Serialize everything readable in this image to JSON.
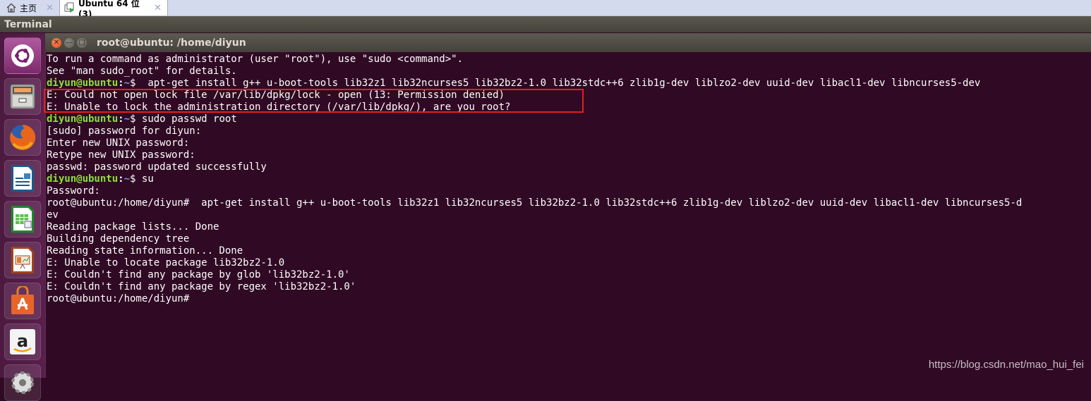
{
  "vmware_tabs": [
    {
      "label": "主页",
      "icon": "home-icon"
    },
    {
      "label": "Ubuntu 64 位 (3)",
      "icon": "vm-running-icon"
    }
  ],
  "panel": {
    "app_name": "Terminal"
  },
  "window": {
    "title": "root@ubuntu: /home/diyun"
  },
  "launcher": [
    {
      "name": "dash-home",
      "icon": "ubuntu-logo-icon"
    },
    {
      "name": "files",
      "icon": "file-cabinet-icon"
    },
    {
      "name": "firefox",
      "icon": "firefox-icon"
    },
    {
      "name": "libreoffice-writer",
      "icon": "writer-document-icon"
    },
    {
      "name": "libreoffice-calc",
      "icon": "calc-spreadsheet-icon"
    },
    {
      "name": "libreoffice-impress",
      "icon": "impress-presentation-icon"
    },
    {
      "name": "software-center",
      "icon": "shopping-bag-icon"
    },
    {
      "name": "amazon",
      "icon": "amazon-icon"
    },
    {
      "name": "system-settings",
      "icon": "gear-icon"
    }
  ],
  "terminal": {
    "lines": [
      {
        "type": "out",
        "text": "To run a command as administrator (user \"root\"), use \"sudo <command>\"."
      },
      {
        "type": "out",
        "text": "See \"man sudo_root\" for details."
      },
      {
        "type": "user",
        "prompt_user": "diyun@ubuntu",
        "prompt_path": "~",
        "prompt_sym": "$",
        "cmd": "  apt-get install g++ u-boot-tools lib32z1 lib32ncurses5 lib32bz2-1.0 lib32stdc++6 zlib1g-dev liblzo2-dev uuid-dev libacl1-dev libncurses5-dev"
      },
      {
        "type": "out",
        "text": "E: Could not open lock file /var/lib/dpkg/lock - open (13: Permission denied)"
      },
      {
        "type": "out",
        "text": "E: Unable to lock the administration directory (/var/lib/dpkg/), are you root?"
      },
      {
        "type": "user",
        "prompt_user": "diyun@ubuntu",
        "prompt_path": "~",
        "prompt_sym": "$",
        "cmd": " sudo passwd root"
      },
      {
        "type": "out",
        "text": "[sudo] password for diyun:"
      },
      {
        "type": "out",
        "text": "Enter new UNIX password:"
      },
      {
        "type": "out",
        "text": "Retype new UNIX password:"
      },
      {
        "type": "out",
        "text": "passwd: password updated successfully"
      },
      {
        "type": "user",
        "prompt_user": "diyun@ubuntu",
        "prompt_path": "~",
        "prompt_sym": "$",
        "cmd": " su"
      },
      {
        "type": "out",
        "text": "Password:"
      },
      {
        "type": "out",
        "text": "root@ubuntu:/home/diyun#  apt-get install g++ u-boot-tools lib32z1 lib32ncurses5 lib32bz2-1.0 lib32stdc++6 zlib1g-dev liblzo2-dev uuid-dev libacl1-dev libncurses5-d"
      },
      {
        "type": "out",
        "text": "ev"
      },
      {
        "type": "out",
        "text": "Reading package lists... Done"
      },
      {
        "type": "out",
        "text": "Building dependency tree"
      },
      {
        "type": "out",
        "text": "Reading state information... Done"
      },
      {
        "type": "out",
        "text": "E: Unable to locate package lib32bz2-1.0"
      },
      {
        "type": "out",
        "text": "E: Couldn't find any package by glob 'lib32bz2-1.0'"
      },
      {
        "type": "out",
        "text": "E: Couldn't find any package by regex 'lib32bz2-1.0'"
      },
      {
        "type": "out",
        "text": "root@ubuntu:/home/diyun# "
      }
    ]
  },
  "watermark": "https://blog.csdn.net/mao_hui_fei",
  "colors": {
    "terminal_bg": "#300a24",
    "prompt_user": "#8ae234",
    "prompt_path": "#729fcf",
    "highlight_box": "#e02020"
  }
}
